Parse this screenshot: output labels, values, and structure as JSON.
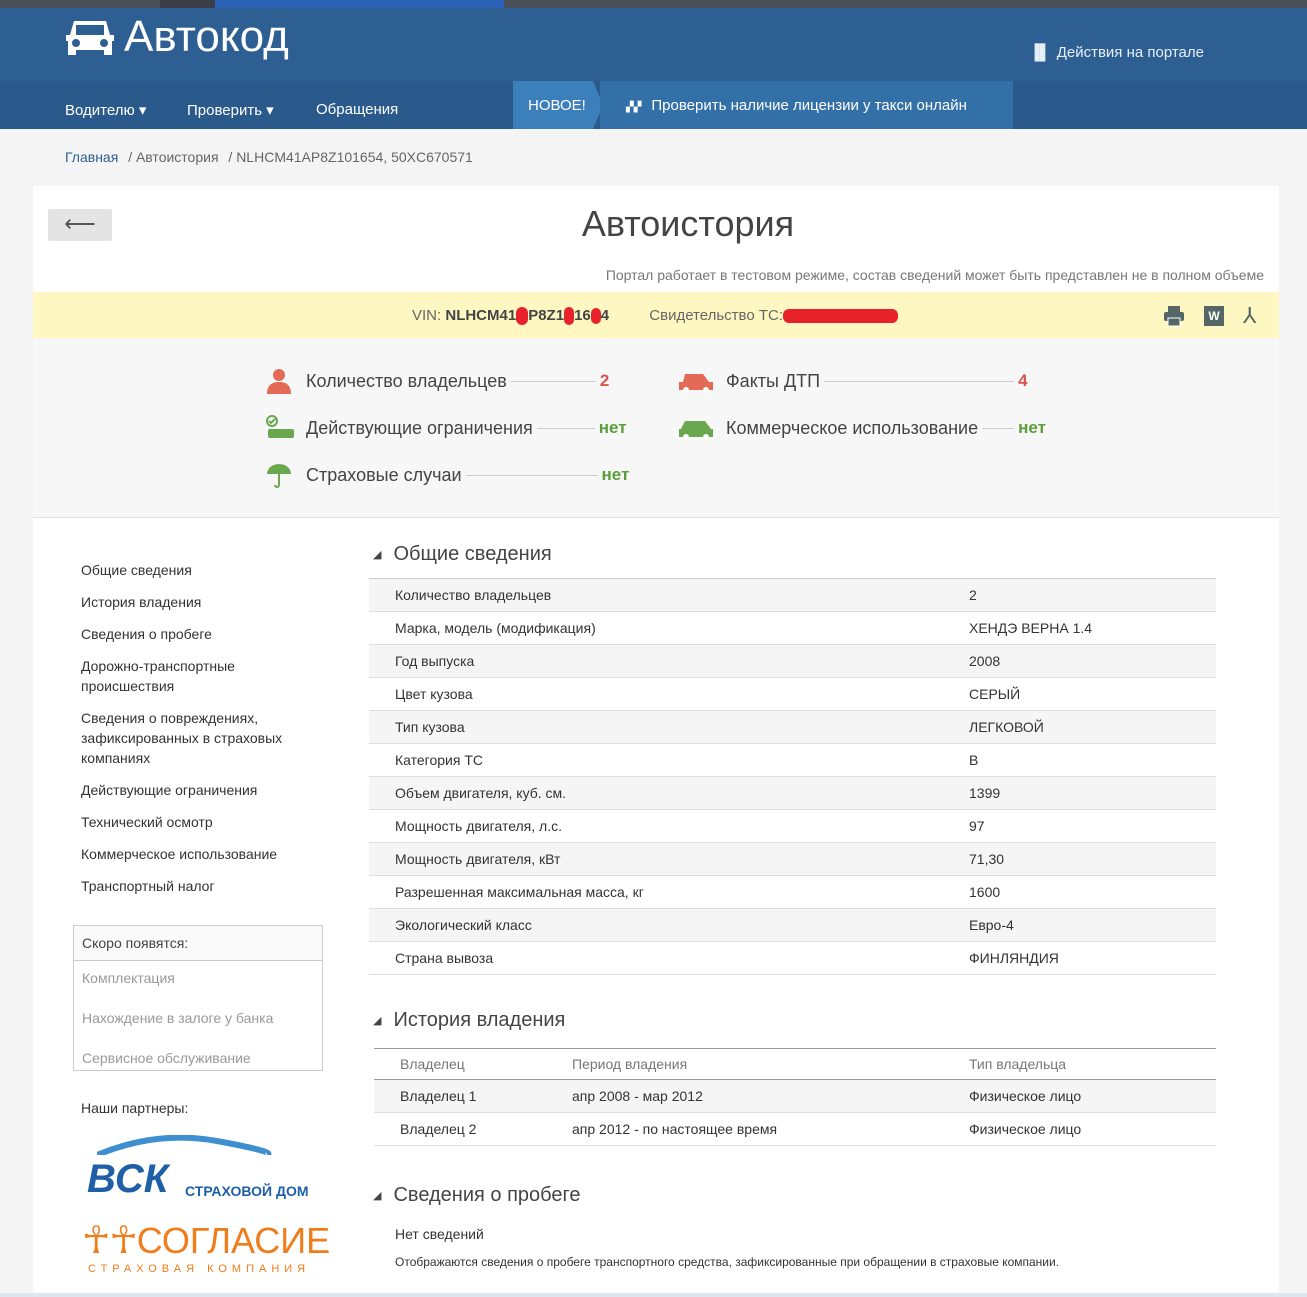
{
  "header": {
    "logo": "Автокод",
    "actions": "Действия на портале"
  },
  "nav": {
    "items": [
      "Водителю ▾",
      "Проверить ▾",
      "Обращения"
    ],
    "new_badge": "НОВОЕ!",
    "new_link": "Проверить наличие лицензии у такси онлайн"
  },
  "breadcrumb": {
    "home": "Главная",
    "section": "/ Автоистория",
    "current": "/ NLHCM41AP8Z101654, 50XC670571"
  },
  "page": {
    "back": "⟵",
    "title": "Автоистория",
    "note": "Портал работает в тестовом режиме, состав сведений может быть представлен не в полном объеме"
  },
  "vin_bar": {
    "vin_label": "VIN:",
    "vin_parts": [
      "NLHCM41",
      "P8Z1",
      "16",
      "4"
    ],
    "cert_label": "Свидетельство ТС:",
    "print": "print-icon",
    "word": "W",
    "pdf": "pdf-icon"
  },
  "summary": [
    {
      "label": "Количество владельцев",
      "value": "2",
      "color": "#d9534f"
    },
    {
      "label": "Действующие ограничения",
      "value": "нет",
      "color": "#5a9e3c"
    },
    {
      "label": "Страховые случаи",
      "value": "нет",
      "color": "#5a9e3c"
    },
    {
      "label": "Факты ДТП",
      "value": "4",
      "color": "#d9534f"
    },
    {
      "label": "Коммерческое использование",
      "value": "нет",
      "color": "#5a9e3c"
    }
  ],
  "sidebar": {
    "items": [
      "Общие сведения",
      "История владения",
      "Сведения о пробеге",
      "Дорожно-транспортные происшествия",
      "Сведения о повреждениях, зафиксированных в страховых компаниях",
      "Действующие ограничения",
      "Технический осмотр",
      "Коммерческое использование",
      "Транспортный налог"
    ],
    "soon_title": "Скоро появятся:",
    "soon": [
      "Комплектация",
      "Нахождение в залоге у банка",
      "Сервисное обслуживание"
    ],
    "partners": "Наши партнеры:",
    "partner1": "ВСК",
    "partner1_sub": "СТРАХОВОЙ ДОМ",
    "partner2": "СОГЛАСИЕ",
    "partner2_sub": "СТРАХОВАЯ КОМПАНИЯ"
  },
  "general": {
    "title": "Общие сведения",
    "rows": [
      [
        "Количество владельцев",
        "2"
      ],
      [
        "Марка, модель (модификация)",
        "ХЕНДЭ ВЕРНА 1.4"
      ],
      [
        "Год выпуска",
        "2008"
      ],
      [
        "Цвет кузова",
        "СЕРЫЙ"
      ],
      [
        "Тип кузова",
        "ЛЕГКОВОЙ"
      ],
      [
        "Категория ТС",
        "B"
      ],
      [
        "Объем двигателя, куб. см.",
        "1399"
      ],
      [
        "Мощность двигателя, л.с.",
        "97"
      ],
      [
        "Мощность двигателя, кВт",
        "71,30"
      ],
      [
        "Разрешенная максимальная масса, кг",
        "1600"
      ],
      [
        "Экологический класс",
        "Евро-4"
      ],
      [
        "Страна вывоза",
        "ФИНЛЯНДИЯ"
      ]
    ]
  },
  "ownership": {
    "title": "История владения",
    "headers": [
      "Владелец",
      "Период владения",
      "Тип владельца"
    ],
    "rows": [
      [
        "Владелец 1",
        "апр 2008 - мар 2012",
        "Физическое лицо"
      ],
      [
        "Владелец 2",
        "апр 2012 - по настоящее время",
        "Физическое лицо"
      ]
    ]
  },
  "mileage": {
    "title": "Сведения о пробеге",
    "none": "Нет сведений",
    "desc": "Отображаются сведения о пробеге транспортного средства, зафиксированные при обращении в страховые компании."
  }
}
